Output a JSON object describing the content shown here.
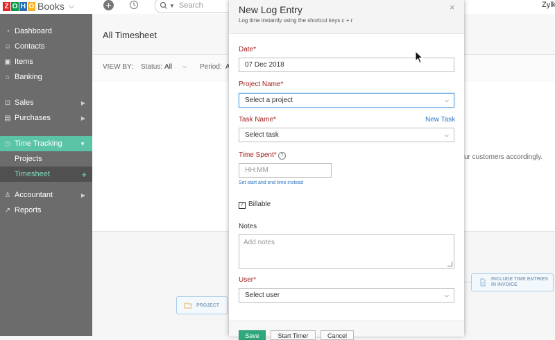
{
  "topbar": {
    "logo_letters": [
      "Z",
      "O",
      "H",
      "O"
    ],
    "logo_colors": [
      "#e42527",
      "#089949",
      "#226db4",
      "#f9b21d"
    ],
    "logo_books": "Books",
    "search_placeholder": "Search",
    "user_name": "Zylk"
  },
  "sidebar": {
    "items": [
      {
        "label": "Dashboard",
        "icon": "dashboard-icon"
      },
      {
        "label": "Contacts",
        "icon": "contacts-icon"
      },
      {
        "label": "Items",
        "icon": "items-icon"
      },
      {
        "label": "Banking",
        "icon": "banking-icon"
      },
      {
        "label": "Sales",
        "icon": "sales-icon"
      },
      {
        "label": "Purchases",
        "icon": "purchases-icon"
      },
      {
        "label": "Time Tracking",
        "icon": "clock-icon"
      },
      {
        "label": "Projects"
      },
      {
        "label": "Timesheet"
      },
      {
        "label": "Accountant",
        "icon": "accountant-icon"
      },
      {
        "label": "Reports",
        "icon": "reports-icon"
      }
    ]
  },
  "main": {
    "title": "All Timesheet",
    "view_by": "VIEW BY:",
    "status_label": "Status:",
    "status_value": "All",
    "period_label": "Period:",
    "period_value": "A",
    "description_fragment": "ur customers accordingly.",
    "flow": {
      "project": "PROJECT",
      "include_line1": "INCLUDE TIME ENTRIES",
      "include_line2": "IN INVOICE"
    }
  },
  "modal": {
    "title": "New Log Entry",
    "subtitle": "Log time instantly using the shortcut keys",
    "shortcut": "c + t",
    "close": "×",
    "date_label": "Date*",
    "date_value": "07 Dec 2018",
    "project_label": "Project Name*",
    "project_value": "Select a project",
    "task_label": "Task Name*",
    "new_task": "New Task",
    "task_value": "Select task",
    "time_label": "Time Spent*",
    "time_placeholder": "HH:MM",
    "set_time_link": "Set start and end time instead",
    "billable_label": "Billable",
    "billable_checked": true,
    "notes_label": "Notes",
    "notes_placeholder": "Add notes",
    "user_label": "User*",
    "user_value": "Select user",
    "buttons": {
      "save": "Save",
      "start_timer": "Start Timer",
      "cancel": "Cancel"
    }
  }
}
